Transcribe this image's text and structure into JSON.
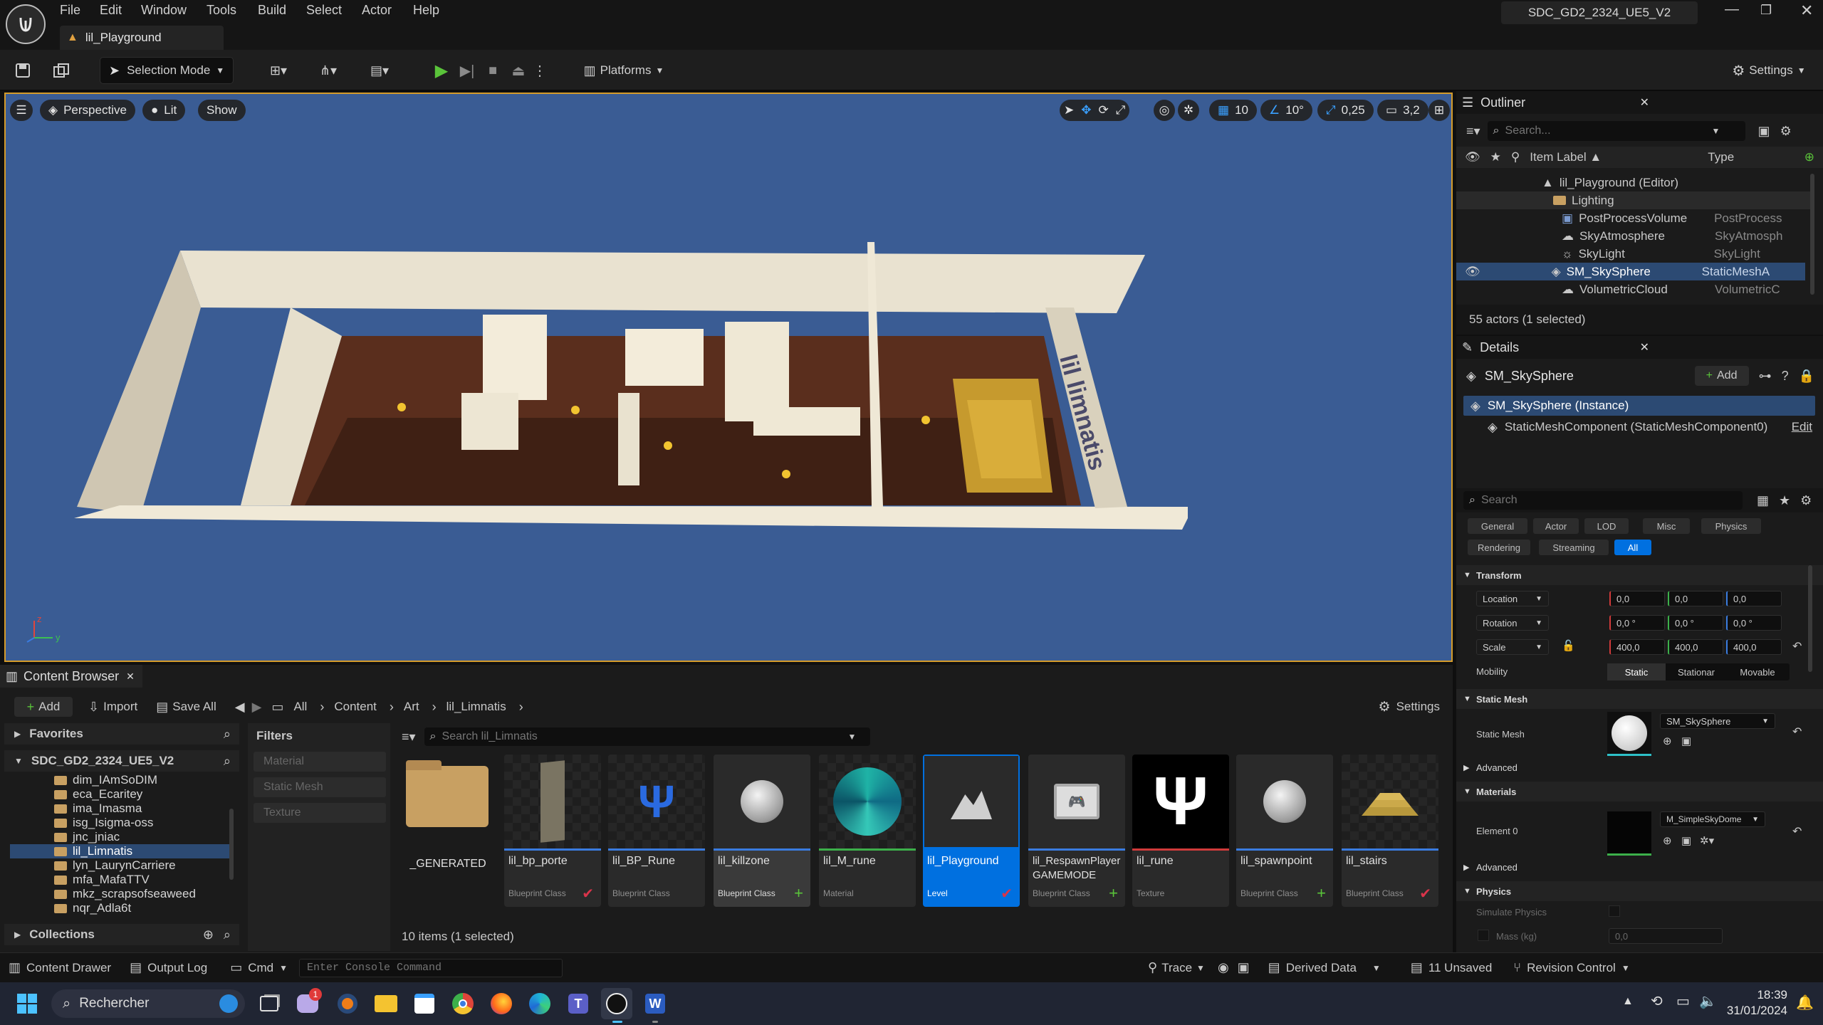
{
  "app": {
    "logo": "unreal-engine-logo",
    "project_name": "SDC_GD2_2324_UE5_V2",
    "level_tab": "lil_Playground"
  },
  "menu": [
    "File",
    "Edit",
    "Window",
    "Tools",
    "Build",
    "Select",
    "Actor",
    "Help"
  ],
  "toolbar": {
    "selection_mode": "Selection Mode",
    "platforms": "Platforms",
    "settings": "Settings"
  },
  "viewport": {
    "perspective": "Perspective",
    "lit": "Lit",
    "show": "Show",
    "grid_snap": "10",
    "rotation_snap": "10°",
    "scale_snap": "0,25",
    "camera_speed": "3,2",
    "sign_text": "lil limnatis",
    "axis": {
      "x": "x",
      "y": "y",
      "z": "z"
    }
  },
  "outliner": {
    "title": "Outliner",
    "search_placeholder": "Search...",
    "col_label": "Item Label ▲",
    "col_type": "Type",
    "rows": [
      {
        "label": "lil_Playground (Editor)",
        "type": ""
      },
      {
        "label": "Lighting",
        "type": ""
      },
      {
        "label": "PostProcessVolume",
        "type": "PostProcess"
      },
      {
        "label": "SkyAtmosphere",
        "type": "SkyAtmosph"
      },
      {
        "label": "SkyLight",
        "type": "SkyLight"
      },
      {
        "label": "SM_SkySphere",
        "type": "StaticMeshA"
      },
      {
        "label": "VolumetricCloud",
        "type": "VolumetricC"
      }
    ],
    "status": "55 actors (1 selected)"
  },
  "details": {
    "title": "Details",
    "object": "SM_SkySphere",
    "add": "Add",
    "instance": "SM_SkySphere (Instance)",
    "component": "StaticMeshComponent (StaticMeshComponent0)",
    "edit": "Edit",
    "search_placeholder": "Search",
    "filters": [
      "General",
      "Actor",
      "LOD",
      "Misc",
      "Physics",
      "Rendering",
      "Streaming",
      "All"
    ],
    "transform": {
      "header": "Transform",
      "location_label": "Location",
      "location": [
        "0,0",
        "0,0",
        "0,0"
      ],
      "rotation_label": "Rotation",
      "rotation": [
        "0,0 °",
        "0,0 °",
        "0,0 °"
      ],
      "scale_label": "Scale",
      "scale": [
        "400,0",
        "400,0",
        "400,0"
      ],
      "mobility_label": "Mobility",
      "mobility": [
        "Static",
        "Stationar",
        "Movable"
      ]
    },
    "static_mesh": {
      "header": "Static Mesh",
      "label": "Static Mesh",
      "value": "SM_SkySphere",
      "advanced": "Advanced"
    },
    "materials": {
      "header": "Materials",
      "element_label": "Element 0",
      "value": "M_SimpleSkyDome",
      "advanced": "Advanced"
    },
    "physics": {
      "header": "Physics",
      "simulate": "Simulate Physics",
      "mass_label": "Mass (kg)",
      "mass": "0,0"
    }
  },
  "content_browser": {
    "title": "Content Browser",
    "add": "Add",
    "import": "Import",
    "save_all": "Save All",
    "breadcrumb": [
      "All",
      "Content",
      "Art",
      "lil_Limnatis"
    ],
    "settings": "Settings",
    "favorites": "Favorites",
    "project_root": "SDC_GD2_2324_UE5_V2",
    "folders": [
      "dim_IAmSoDIM",
      "eca_Ecaritey",
      "ima_Imasma",
      "isg_Isigma-oss",
      "jnc_jniac",
      "lil_Limnatis",
      "lyn_LaurynCarriere",
      "mfa_MafaTTV",
      "mkz_scrapsofseaweed",
      "nqr_Adla6t"
    ],
    "collections": "Collections",
    "filters_title": "Filters",
    "filter_items": [
      "Material",
      "Static Mesh",
      "Texture"
    ],
    "search_placeholder": "Search lil_Limnatis",
    "assets": [
      {
        "name": "_GENERATED",
        "type": ""
      },
      {
        "name": "lil_bp_porte",
        "type": "Blueprint Class"
      },
      {
        "name": "lil_BP_Rune",
        "type": "Blueprint Class"
      },
      {
        "name": "lil_killzone",
        "type": "Blueprint Class"
      },
      {
        "name": "lil_M_rune",
        "type": "Material"
      },
      {
        "name": "lil_Playground",
        "type": "Level"
      },
      {
        "name": "lil_RespawnPlayer GAMEMODE",
        "type": "Blueprint Class"
      },
      {
        "name": "lil_rune",
        "type": "Texture"
      },
      {
        "name": "lil_spawnpoint",
        "type": "Blueprint Class"
      },
      {
        "name": "lil_stairs",
        "type": "Blueprint Class"
      }
    ],
    "item_count": "10 items (1 selected)"
  },
  "statusbar": {
    "content_drawer": "Content Drawer",
    "output_log": "Output Log",
    "cmd": "Cmd",
    "console_placeholder": "Enter Console Command",
    "trace": "Trace",
    "derived_data": "Derived Data",
    "unsaved": "11 Unsaved",
    "revision_control": "Revision Control"
  },
  "taskbar": {
    "search": "Rechercher",
    "time": "18:39",
    "date": "31/01/2024",
    "notification_badge": "1"
  },
  "colors": {
    "accent": "#0070e0",
    "viewport_bg": "#3a5c94",
    "selection_border": "#d49b2a",
    "play_green": "#5ac43a"
  }
}
